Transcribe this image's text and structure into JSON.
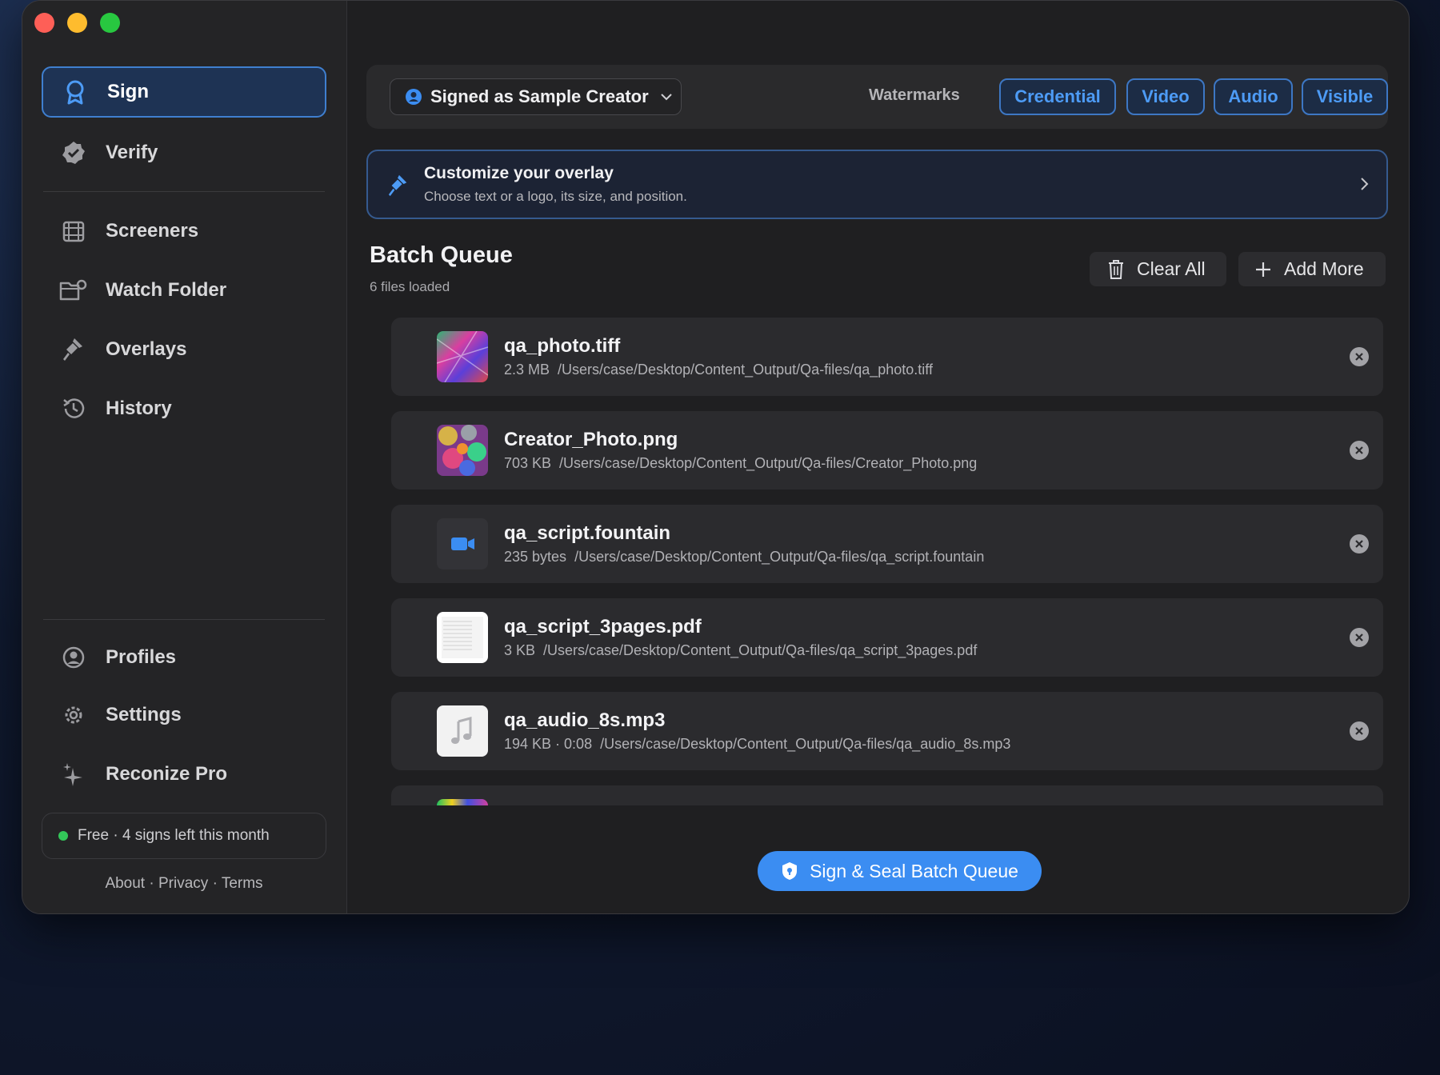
{
  "sidebar": {
    "items": [
      {
        "label": "Sign",
        "icon": "award-icon",
        "active": true
      },
      {
        "label": "Verify",
        "icon": "verified-badge-icon"
      },
      {
        "label": "Screeners",
        "icon": "film-icon"
      },
      {
        "label": "Watch Folder",
        "icon": "folder-gear-icon"
      },
      {
        "label": "Overlays",
        "icon": "stamp-icon"
      },
      {
        "label": "History",
        "icon": "history-icon"
      },
      {
        "label": "Profiles",
        "icon": "user-circle-icon"
      },
      {
        "label": "Settings",
        "icon": "gear-icon"
      },
      {
        "label": "Reconize Pro",
        "icon": "sparkle-icon"
      }
    ],
    "plan_status": "Free · 4 signs left this month",
    "footer": {
      "about": "About",
      "privacy": "Privacy",
      "terms": "Terms",
      "sep": "·"
    }
  },
  "topbar": {
    "signed_as": "Signed as Sample Creator",
    "watermarks_label": "Watermarks",
    "watermarks": [
      "Credential",
      "Video",
      "Audio",
      "Visible"
    ]
  },
  "overlay_card": {
    "title": "Customize your overlay",
    "subtitle": "Choose text or a logo, its size, and position."
  },
  "batch": {
    "title": "Batch Queue",
    "subtitle": "6 files loaded",
    "clear_label": "Clear All",
    "add_label": "Add More",
    "files": [
      {
        "name": "qa_photo.tiff",
        "size": "2.3 MB",
        "path": "/Users/case/Desktop/Content_Output/Qa-files/qa_photo.tiff",
        "thumb": "photo"
      },
      {
        "name": "Creator_Photo.png",
        "size": "703 KB",
        "path": "/Users/case/Desktop/Content_Output/Qa-files/Creator_Photo.png",
        "thumb": "bokeh"
      },
      {
        "name": "qa_script.fountain",
        "size": "235 bytes",
        "path": "/Users/case/Desktop/Content_Output/Qa-files/qa_script.fountain",
        "thumb": "video-camera-icon"
      },
      {
        "name": "qa_script_3pages.pdf",
        "size": "3 KB",
        "path": "/Users/case/Desktop/Content_Output/Qa-files/qa_script_3pages.pdf",
        "thumb": "document"
      },
      {
        "name": "qa_audio_8s.mp3",
        "size": "194 KB · 0:08",
        "path": "/Users/case/Desktop/Content_Output/Qa-files/qa_audio_8s.mp3",
        "thumb": "music-note-icon"
      },
      {
        "name": "",
        "size": "",
        "path": "",
        "thumb": "gradient"
      }
    ]
  },
  "primary_action": "Sign & Seal Batch Queue",
  "colors": {
    "accent": "#3b8df2",
    "active_bg": "#1e3354",
    "status_green": "#33c759"
  }
}
